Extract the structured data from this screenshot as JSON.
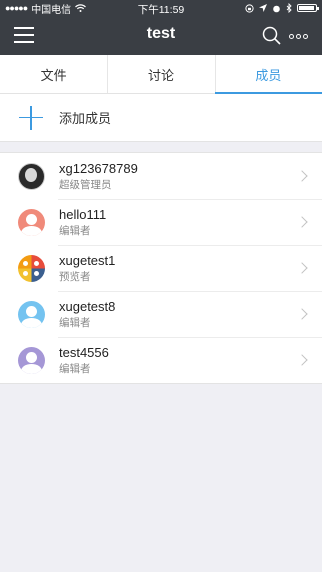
{
  "status_bar": {
    "carrier": "中国电信",
    "time": "下午11:59"
  },
  "navbar": {
    "title": "test"
  },
  "tabs": [
    {
      "label": "文件",
      "active": false
    },
    {
      "label": "讨论",
      "active": false
    },
    {
      "label": "成员",
      "active": true
    }
  ],
  "add_member": {
    "label": "添加成员"
  },
  "members": [
    {
      "name": "xg123678789",
      "role": "超级管理员",
      "avatar": "photo",
      "color": "#2a2a2a"
    },
    {
      "name": "hello111",
      "role": "编辑者",
      "avatar": "person",
      "color": "#f08a7a"
    },
    {
      "name": "xugetest1",
      "role": "预览者",
      "avatar": "quad",
      "color": "#f2c12e"
    },
    {
      "name": "xugetest8",
      "role": "编辑者",
      "avatar": "person",
      "color": "#74c3f0"
    },
    {
      "name": "test4556",
      "role": "编辑者",
      "avatar": "person",
      "color": "#a597d6"
    }
  ],
  "colors": {
    "header_bg": "#3a3e44",
    "accent": "#3c9ae0"
  }
}
